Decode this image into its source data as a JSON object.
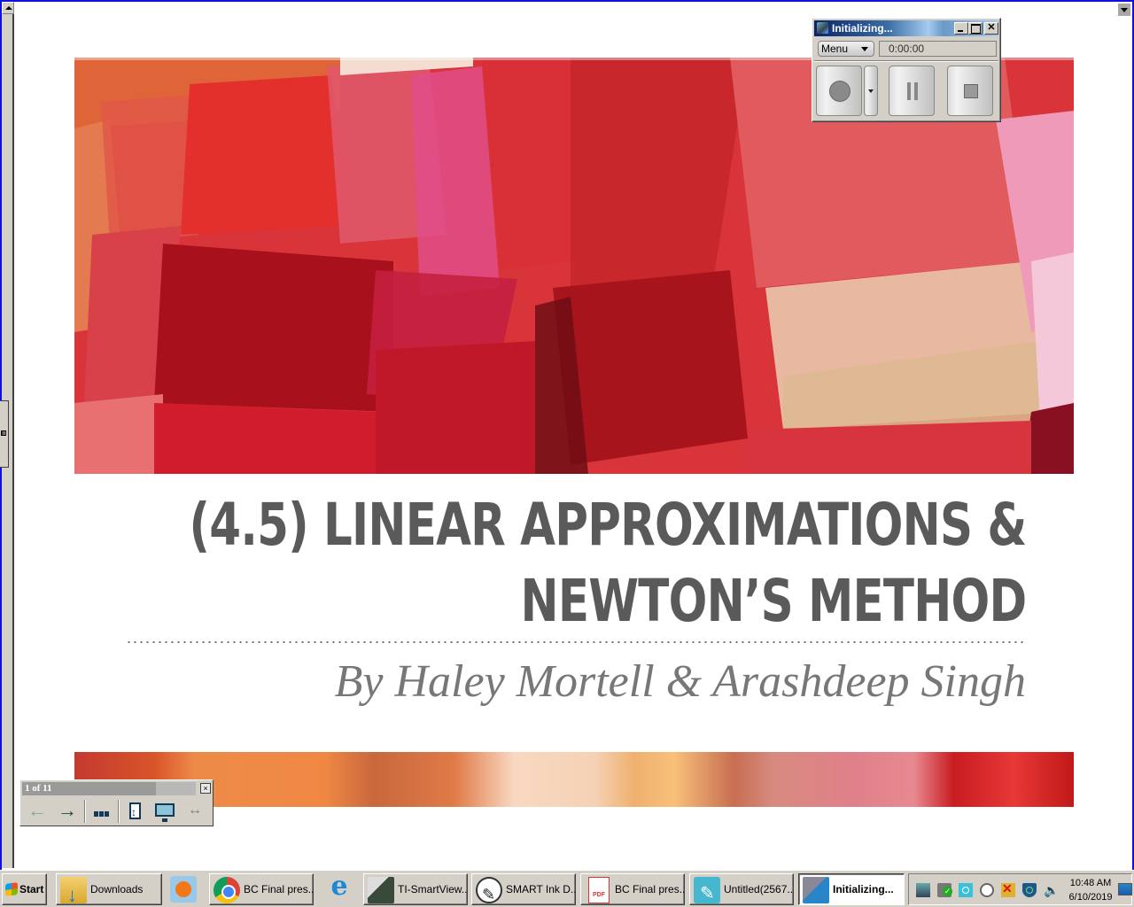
{
  "slide": {
    "title_line1": "(4.5) LINEAR APPROXIMATIONS &",
    "title_line2": "NEWTON’S METHOD",
    "byline": "By Haley Mortell & Arashdeep Singh"
  },
  "recorder": {
    "title": "Initializing...",
    "menu_label": "Menu",
    "elapsed": "0:00:00",
    "buttons": {
      "record": "record-button",
      "pause": "pause-button",
      "stop": "stop-button"
    }
  },
  "slide_navigator": {
    "position": "1 of 11",
    "close_glyph": "×",
    "prev_glyph": "←",
    "next_glyph": "→",
    "width_glyph": "↔"
  },
  "taskbar": {
    "start_label": "Start",
    "items": [
      {
        "label": "Downloads",
        "icon": "folder-download-icon"
      },
      {
        "label": "",
        "icon": "media-player-icon"
      },
      {
        "label": "BC Final pres...",
        "icon": "chrome-icon"
      },
      {
        "label": "",
        "icon": "internet-explorer-icon"
      },
      {
        "label": "TI-SmartView...",
        "icon": "ti-smartview-icon"
      },
      {
        "label": "SMART Ink D...",
        "icon": "smart-ink-icon"
      },
      {
        "label": "BC Final pres...",
        "icon": "pdf-icon"
      },
      {
        "label": "Untitled(2567...",
        "icon": "notebook-icon"
      },
      {
        "label": "Initializing...",
        "icon": "recorder-icon",
        "active": true
      }
    ],
    "ie_glyph": "e",
    "tray": {
      "time": "10:48 AM",
      "date": "6/10/2019",
      "volume_glyph": "🔈"
    }
  }
}
